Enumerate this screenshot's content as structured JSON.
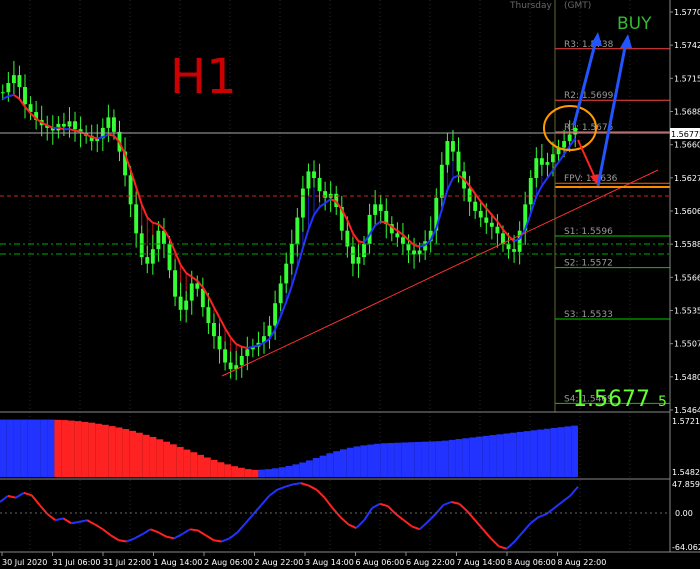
{
  "header": {
    "time_label": "Thursday",
    "tz_label": "(GMT)"
  },
  "timeframe": "H1",
  "signal": "BUY",
  "price_display": {
    "big": "1.5677",
    "small": "5"
  },
  "current_price_tag": "1.56775",
  "colors": {
    "background": "#000000",
    "candle": "#33ff33",
    "ma_up": "#2233ff",
    "ma_down": "#ff2222",
    "pivot_line": "#ff4444",
    "support_line": "#00cc00",
    "level_text": "#999999",
    "fpv_line": "#ff6600",
    "title_red": "#cc0000",
    "buy_green": "#33bb33",
    "price_big": "#66ff33",
    "arrow_blue": "#2255ff",
    "circle_orange": "#ff9900",
    "axis_text": "#ffffff"
  },
  "levels": [
    {
      "label": "R3: 1.5738",
      "price": 1.5738
    },
    {
      "label": "R2: 1.5699",
      "price": 1.5699
    },
    {
      "label": "R1: 1.5675",
      "price": 1.5675
    },
    {
      "label": "FPV: 1.5636",
      "price": 1.5636
    },
    {
      "label": "S1: 1.5596",
      "price": 1.5596
    },
    {
      "label": "S2: 1.5572",
      "price": 1.5572
    },
    {
      "label": "S3: 1.5533",
      "price": 1.5533
    },
    {
      "label": "S4: 1.5469",
      "price": 1.5469
    }
  ],
  "price_axis": [
    "1.57700",
    "1.57425",
    "1.57150",
    "1.56880",
    "1.56605",
    "1.56270",
    "1.56065",
    "1.55885",
    "1.55660",
    "1.55350",
    "1.55075",
    "1.54805",
    "1.54640"
  ],
  "time_axis": [
    "30 Jul 2020",
    "31 Jul 06:00",
    "31 Jul 22:00",
    "1 Aug 14:00",
    "2 Aug 06:00",
    "2 Aug 22:00",
    "3 Aug 14:00",
    "6 Aug 06:00",
    "6 Aug 22:00",
    "7 Aug 14:00",
    "8 Aug 06:00",
    "8 Aug 22:00"
  ],
  "histogram_axis": {
    "top": "1.5721",
    "bottom": "1.5482"
  },
  "oscillator_axis": {
    "top": "47.8591",
    "mid": "0.00",
    "bottom": "-64.0627"
  },
  "chart_data": [
    {
      "type": "line",
      "title": "",
      "ylim": [
        1.5464,
        1.5775
      ],
      "xlim": [
        0,
        144
      ],
      "series": [
        {
          "values": [
            1.5705,
            1.5712,
            1.5718,
            1.5709,
            1.5696,
            1.569,
            1.5684,
            1.568,
            1.5678,
            1.5676,
            1.5681,
            1.5679,
            1.5683,
            1.5677,
            1.5674,
            1.5672,
            1.5668,
            1.567,
            1.5678,
            1.5686,
            1.5675,
            1.566,
            1.5642,
            1.562,
            1.5598,
            1.558,
            1.5575,
            1.5586,
            1.56,
            1.559,
            1.557,
            1.555,
            1.554,
            1.5547,
            1.556,
            1.5556,
            1.5542,
            1.553,
            1.552,
            1.551,
            1.55,
            1.5495,
            1.5498,
            1.5505,
            1.551,
            1.5512,
            1.5515,
            1.552,
            1.5528,
            1.5545,
            1.556,
            1.5575,
            1.559,
            1.561,
            1.5632,
            1.5645,
            1.564,
            1.563,
            1.5625,
            1.5628,
            1.5618,
            1.56,
            1.5588,
            1.5575,
            1.558,
            1.559,
            1.5612,
            1.562,
            1.5615,
            1.5605,
            1.5598,
            1.5595,
            1.559,
            1.5585,
            1.5582,
            1.5585,
            1.5592,
            1.56,
            1.5625,
            1.565,
            1.5668,
            1.566,
            1.5645,
            1.5632,
            1.5622,
            1.5615,
            1.561,
            1.5606,
            1.5603,
            1.5598,
            1.559,
            1.5586,
            1.5584,
            1.56,
            1.562,
            1.564,
            1.5655,
            1.565,
            1.5652,
            1.5658,
            1.5663,
            1.5668,
            1.5673,
            1.5678
          ]
        },
        {
          "name": "",
          "values": [
            1.57,
            1.5702,
            1.5703,
            1.57,
            1.5694,
            1.5689,
            1.5685,
            1.5682,
            1.568,
            1.5678,
            1.5678,
            1.5677,
            1.5677,
            1.5676,
            1.5675,
            1.5673,
            1.5671,
            1.567,
            1.5671,
            1.5673,
            1.5672,
            1.5667,
            1.5658,
            1.5646,
            1.5633,
            1.562,
            1.561,
            1.5606,
            1.5605,
            1.5601,
            1.5594,
            1.5584,
            1.5574,
            1.5568,
            1.5565,
            1.5562,
            1.5557,
            1.555,
            1.5542,
            1.5534,
            1.5526,
            1.5519,
            1.5514,
            1.5512,
            1.5511,
            1.5512,
            1.5513,
            1.5515,
            1.5518,
            1.5525,
            1.5535,
            1.5546,
            1.5558,
            1.5572,
            1.5587,
            1.5601,
            1.5612,
            1.5618,
            1.5621,
            1.5624,
            1.5622,
            1.5616,
            1.5608,
            1.5598,
            1.5592,
            1.5591,
            1.5597,
            1.5604,
            1.5607,
            1.5606,
            1.5603,
            1.56,
            1.5597,
            1.5593,
            1.5589,
            1.5588,
            1.5589,
            1.5593,
            1.5602,
            1.5616,
            1.5631,
            1.564,
            1.5642,
            1.5639,
            1.5634,
            1.5628,
            1.5622,
            1.5617,
            1.5612,
            1.5607,
            1.5601,
            1.5596,
            1.5592,
            1.5594,
            1.5601,
            1.5613,
            1.5626,
            1.5634,
            1.564,
            1.5646,
            1.5652,
            1.5658,
            1.5664,
            1.567
          ]
        }
      ]
    },
    {
      "type": "bar",
      "title": "",
      "ylim": [
        1.5482,
        1.5721
      ],
      "values": [
        1.57,
        1.57,
        1.57,
        1.57,
        1.57,
        1.57,
        1.57,
        1.57,
        1.5699,
        1.5698,
        1.5696,
        1.5694,
        1.5691,
        1.5688,
        1.5684,
        1.568,
        1.5675,
        1.567,
        1.5664,
        1.5657,
        1.565,
        1.5642,
        1.5634,
        1.5625,
        1.5616,
        1.5606,
        1.5596,
        1.5586,
        1.5576,
        1.5566,
        1.5556,
        1.5547,
        1.5538,
        1.553,
        1.5523,
        1.5517,
        1.5512,
        1.5509,
        1.551,
        1.5512,
        1.5515,
        1.5519,
        1.5524,
        1.553,
        1.5537,
        1.5545,
        1.5554,
        1.5563,
        1.5572,
        1.558,
        1.5587,
        1.5593,
        1.5598,
        1.5602,
        1.5605,
        1.5608,
        1.561,
        1.5611,
        1.5612,
        1.5613,
        1.5614,
        1.5615,
        1.5616,
        1.5617,
        1.5618,
        1.562,
        1.5623,
        1.5626,
        1.5629,
        1.5632,
        1.5635,
        1.5638,
        1.5641,
        1.5644,
        1.5647,
        1.565,
        1.5653,
        1.5656,
        1.5659,
        1.5662,
        1.5665,
        1.5668,
        1.5671,
        1.5674,
        1.5677
      ]
    },
    {
      "type": "line",
      "title": "",
      "ylim": [
        -64.0627,
        47.8591
      ],
      "values": [
        15,
        25,
        22,
        30,
        26,
        10,
        -5,
        -15,
        -12,
        -20,
        -18,
        -15,
        -22,
        -30,
        -40,
        -48,
        -50,
        -45,
        -38,
        -30,
        -35,
        -42,
        -45,
        -38,
        -30,
        -32,
        -40,
        -48,
        -50,
        -45,
        -35,
        -20,
        -5,
        10,
        25,
        35,
        40,
        44,
        46,
        42,
        35,
        22,
        5,
        -10,
        -22,
        -28,
        -15,
        5,
        12,
        8,
        -5,
        -15,
        -25,
        -30,
        -18,
        -5,
        10,
        15,
        12,
        0,
        -15,
        -30,
        -45,
        -58,
        -62,
        -50,
        -35,
        -20,
        -10,
        -5,
        5,
        15,
        25,
        40
      ]
    }
  ]
}
